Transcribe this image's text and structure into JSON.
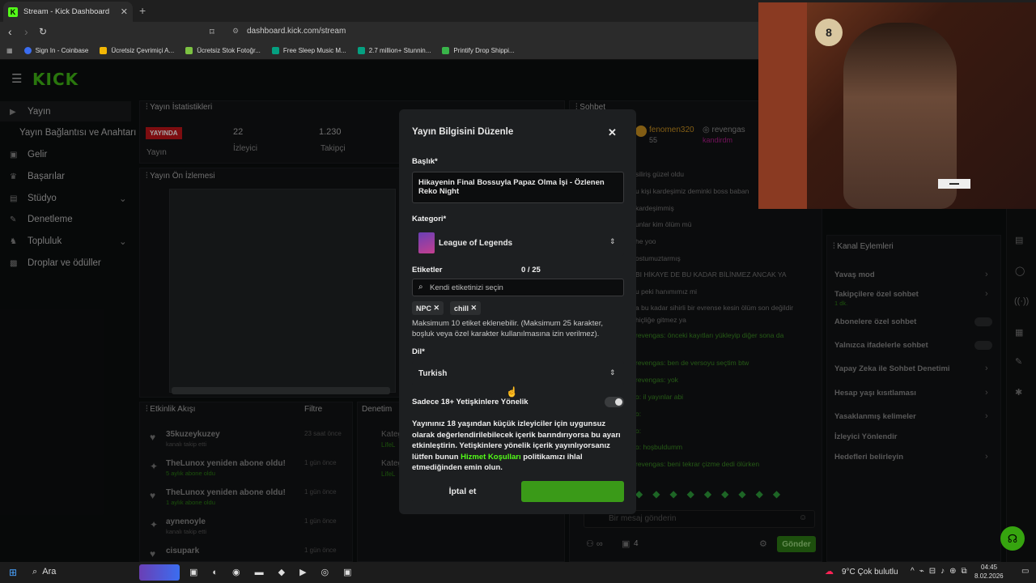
{
  "browser": {
    "tab_title": "Stream - Kick Dashboard",
    "url": "dashboard.kick.com/stream",
    "bookmarks": [
      "Sign In - Coinbase",
      "Ücretsiz Çevrimiçi A...",
      "Ücretsiz Stok Fotoğr...",
      "Free Sleep Music M...",
      "2.7 million+ Stunnin...",
      "Printify Drop Shippi..."
    ]
  },
  "logo": "KICK",
  "sidebar": {
    "items": [
      {
        "label": "Yayın"
      },
      {
        "label": "Yayın Bağlantısı ve Anahtarı"
      },
      {
        "label": "Gelir"
      },
      {
        "label": "Başarılar"
      },
      {
        "label": "Stüdyo"
      },
      {
        "label": "Denetleme"
      },
      {
        "label": "Topluluk"
      },
      {
        "label": "Droplar ve ödüller"
      }
    ]
  },
  "stats": {
    "title": "Yayın İstatistikleri",
    "live_badge": "YAYINDA",
    "viewers_value": "22",
    "followers_value": "1.230",
    "stream_label": "Yayın",
    "viewers_label": "İzleyici",
    "followers_label": "Takipçi"
  },
  "preview_title": "Yayın Ön İzlemesi",
  "activity": {
    "title": "Etkinlik Akışı",
    "filter": "Filtre",
    "items": [
      {
        "name": "35kuzeykuzey",
        "sub": "kanalı takip etti",
        "time": "23 saat önce"
      },
      {
        "name": "TheLunox yeniden abone oldu!",
        "sub": "5 aylık abone oldu",
        "time": "1 gün önce"
      },
      {
        "name": "TheLunox yeniden abone oldu!",
        "sub": "1 aylık abone oldu",
        "time": "1 gün önce"
      },
      {
        "name": "aynenoyle",
        "sub": "kanalı takip etti",
        "time": "1 gün önce"
      },
      {
        "name": "cisupark",
        "sub": "",
        "time": "1 gün önce"
      }
    ]
  },
  "mid_panel": {
    "title": "Denetim",
    "rows": [
      "Kateg",
      "LifeL",
      "Kateg",
      "LifeL"
    ]
  },
  "chat": {
    "title": "Sohbet",
    "user1": "fenomen320",
    "user1_sub": "55",
    "user2": "revengas",
    "user2_sub": "kandirdm",
    "lines": [
      "siliriş güzel oldu",
      "u kişi kardeşimiz deminki boss baban",
      "kardeşimmiş",
      "unlar kim ölüm mü",
      "he yoo",
      "ostumuztarmış",
      "BI HİKAYE DE BU KADAR BİLİNMEZ ANCAK YA",
      "u peki hanımımız mi",
      "a bu kadar sihirli bir evrense kesin ölüm son değildir",
      "hiçliğe gitmez ya",
      "revengas: önceki kayıtları yükleyip diğer sona da",
      "revengas: ben de versoyu seçtim btw",
      "revengas: yok",
      "o: il yayınlar abi",
      "o:",
      "o:",
      "o: hoşbuldumm",
      "revengas: beni tekrar çizme dedi ölürken"
    ],
    "input_placeholder": "Bir mesaj gönderin",
    "send": "Gönder",
    "count": "4"
  },
  "channel_actions": {
    "title": "Kanal Eylemleri",
    "items": [
      {
        "label": "Yavaş mod",
        "sub": ""
      },
      {
        "label": "Takipçilere özel sohbet",
        "sub": "1 dk."
      },
      {
        "label": "Abonelere özel sohbet",
        "sub": ""
      },
      {
        "label": "Yalnızca ifadelerle sohbet",
        "sub": ""
      },
      {
        "label": "Yapay Zeka ile Sohbet Denetimi",
        "sub": ""
      },
      {
        "label": "Hesap yaşı kısıtlaması",
        "sub": ""
      },
      {
        "label": "Yasaklanmış kelimeler",
        "sub": ""
      },
      {
        "label": "İzleyici Yönlendir",
        "sub": ""
      },
      {
        "label": "Hedefleri belirleyin",
        "sub": ""
      }
    ]
  },
  "modal": {
    "title": "Yayın Bilgisini Düzenle",
    "title_label": "Başlık*",
    "title_value": "Hikayenin Final Bossuyla Papaz Olma İşi - Özlenen Reko Night",
    "category_label": "Kategori*",
    "category_value": "League of Legends",
    "tags_label": "Etiketler",
    "tags_count": "0 / 25",
    "tags_placeholder": "Kendi etiketinizi seçin",
    "tags": [
      "NPC",
      "chill"
    ],
    "tags_help": "Maksimum 10 etiket eklenebilir. (Maksimum 25 karakter, boşluk veya özel karakter kullanılmasına izin verilmez).",
    "language_label": "Dil*",
    "language_value": "Turkish",
    "adult_label": "Sadece 18+ Yetişkinlere Yönelik",
    "adult_help_1": "Yayınınız 18 yaşından küçük izleyiciler için uygunsuz olarak değerlendirilebilecek içerik barındırıyorsa bu ayarı etkinleştirin. Yetişkinlere yönelik içerik yayınlıyorsanız lütfen bunun ",
    "adult_help_link": "Hizmet Koşulları",
    "adult_help_2": " politikamızı ihlal etmediğinden emin olun.",
    "cancel": "İptal et"
  },
  "taskbar": {
    "search": "Ara",
    "weather": "9°C  Çok bulutlu",
    "time": "04:45",
    "date": "8.02.2026"
  },
  "colors": {
    "accent": "#53fc18",
    "live": "#c0141a"
  }
}
